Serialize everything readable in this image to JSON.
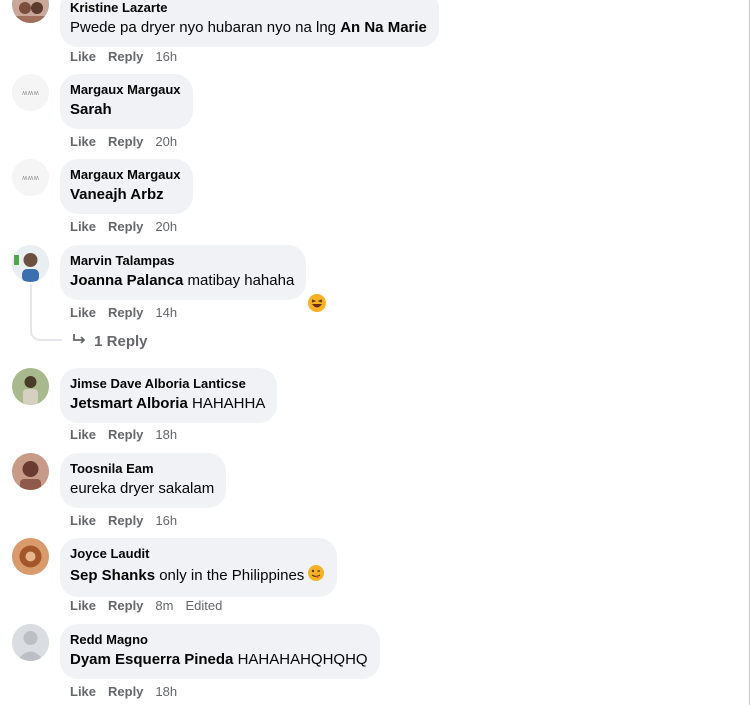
{
  "comments": [
    {
      "author": "Kristine Lazarte",
      "prefix": "Pwede pa dryer nyo hubaran nyo na lng ",
      "mention": "An Na Marie",
      "suffix": "",
      "like": "Like",
      "reply": "Reply",
      "time": "16h"
    },
    {
      "author": "Margaux Margaux",
      "prefix": "",
      "mention": "Sarah",
      "suffix": "",
      "like": "Like",
      "reply": "Reply",
      "time": "20h"
    },
    {
      "author": "Margaux Margaux",
      "prefix": "",
      "mention": "Vaneajh Arbz",
      "suffix": "",
      "like": "Like",
      "reply": "Reply",
      "time": "20h"
    },
    {
      "author": "Marvin Talampas",
      "prefix": "",
      "mention": "Joanna Palanca",
      "suffix": " matibay hahaha",
      "like": "Like",
      "reply": "Reply",
      "time": "14h",
      "replies": "1 Reply",
      "reaction_icon": "laughing-emoji-icon"
    },
    {
      "author": "Jimse Dave Alboria Lanticse",
      "prefix": "",
      "mention": "Jetsmart Alboria",
      "suffix": " HAHAHHA",
      "like": "Like",
      "reply": "Reply",
      "time": "18h"
    },
    {
      "author": "Toosnila Eam",
      "prefix": "eureka dryer sakalam",
      "mention": "",
      "suffix": "",
      "like": "Like",
      "reply": "Reply",
      "time": "16h"
    },
    {
      "author": "Joyce Laudit",
      "prefix": "",
      "mention": "Sep Shanks",
      "suffix": " only in the Philippines",
      "like": "Like",
      "reply": "Reply",
      "time": "8m",
      "edited": "Edited",
      "inline_emoji": "winking-tongue-emoji-icon"
    },
    {
      "author": "Redd Magno",
      "prefix": "",
      "mention": "Dyam Esquerra Pineda",
      "suffix": " HAHAHAHQHQHQ",
      "like": "Like",
      "reply": "Reply",
      "time": "18h"
    }
  ],
  "colors": {
    "bubble": "#f0f2f5",
    "meta": "#65676b",
    "text": "#050505",
    "emoji": "#f7b125"
  }
}
